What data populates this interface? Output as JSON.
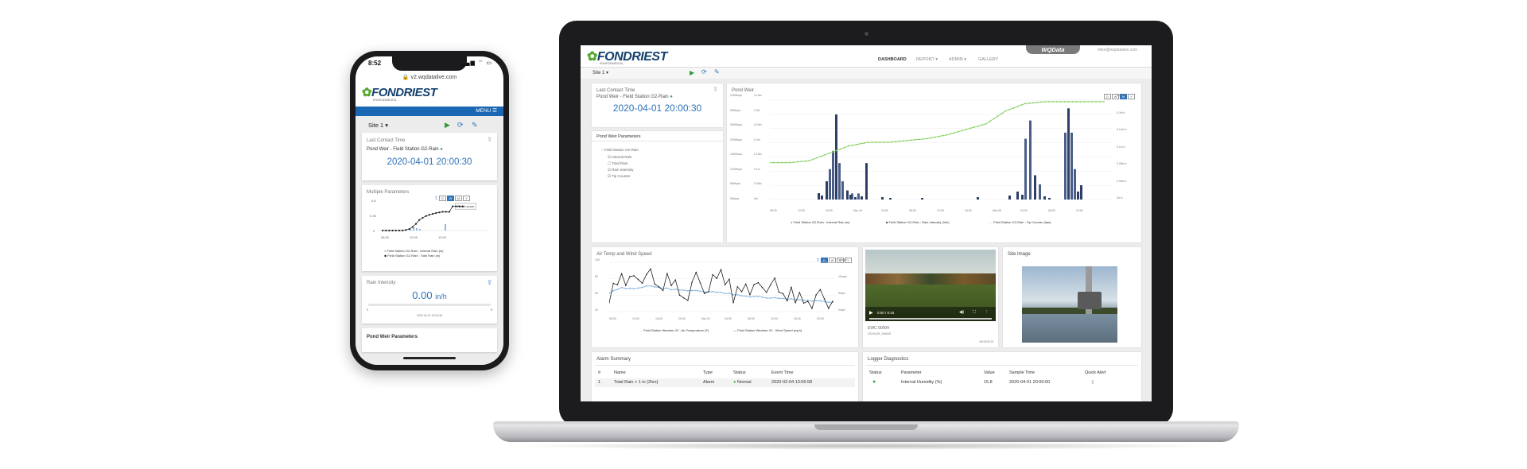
{
  "phone": {
    "status_time": "8:52",
    "url": "v2.wqdatalive.com",
    "logo": "FONDRIEST",
    "logo_sub": "ENVIRONMENTAL",
    "menu_label": "MENU",
    "site_select": "Site 1",
    "last_contact": {
      "title": "Last Contact Time",
      "station": "Pond Weir - Field Station G2-Rain",
      "value": "2020-04-01 20:00:30"
    },
    "multi_params": {
      "title": "Multiple Parameters",
      "zoom_buttons": [
        "D",
        "W",
        "M",
        "Y"
      ],
      "reset_zoom": "Reset zoom",
      "y_ticks": [
        "0.8",
        "0.35",
        "0"
      ],
      "x_ticks": [
        "08:00",
        "12:00",
        "13:00"
      ],
      "legend": [
        "Field Station G2-Rain : Interval Rain (in)",
        "Field Station G2-Rain : Total Rain (in)"
      ]
    },
    "rain_intensity": {
      "title": "Rain Intensity",
      "value": "0.00",
      "unit": "in/h",
      "min": "0",
      "max": "5",
      "time": "2020-04-01 20:00:30"
    },
    "pond_weir_title": "Pond Weir Parameters"
  },
  "laptop": {
    "logo": "FONDRIEST",
    "logo_sub": "ENVIRONMENTAL",
    "nav": [
      "DASHBOARD",
      "REPORT ▾",
      "ADMIN ▾",
      "GALLERY"
    ],
    "brand": "WQData",
    "email": "mike@wqdatalive.com",
    "site_select": "Site 1",
    "last_contact": {
      "title": "Last Contact Time",
      "station": "Pond Weir - Field Station G2-Rain",
      "value": "2020-04-01 20:00:30"
    },
    "pond_weir_params": {
      "title": "Pond Weir Parameters",
      "root": "Field Station G2-Rain",
      "items": [
        {
          "label": "Interval Rain",
          "checked": true
        },
        {
          "label": "Total Rain",
          "checked": false
        },
        {
          "label": "Rain Intensity",
          "checked": true
        },
        {
          "label": "Tip Counter",
          "checked": true
        }
      ]
    },
    "pond_weir_chart": {
      "title": "Pond Weir",
      "zoom_buttons": [
        "D",
        "W",
        "M",
        "Y"
      ],
      "left_ticks": [
        "100Wspa",
        "50Wspa",
        "250Wspa",
        "200Wspa",
        "150Wspa",
        "100Wspa",
        "50Wspa",
        "0Wspa"
      ],
      "mid_ticks": [
        "0.14in",
        "0.3in",
        "0.24in",
        "0.2in",
        "0.15in",
        "0.1in",
        "0.05in",
        "0in"
      ],
      "right_ticks": [
        "0.15in h",
        "0.3in h",
        "0.14in h",
        "0.1in h",
        "0.05in h",
        "0.05in h",
        "0in h"
      ],
      "x_ticks": [
        "08:00",
        "12:00",
        "16:00",
        "Mar 16",
        "04:00",
        "08:00",
        "12:00",
        "16:00",
        "Mar 26",
        "04:00",
        "08:00",
        "12:00"
      ],
      "legend": [
        "Field Station G2-Rain : Interval Rain (in)",
        "Field Station G2-Rain : Rain Intensity (in/h)",
        "Field Station G2-Rain : Tip Counter (tips)"
      ]
    },
    "air_temp_chart": {
      "title": "Air Temp and Wind Speed",
      "zoom_buttons": [
        "D",
        "W",
        "M",
        "Y"
      ],
      "left_ticks": [
        "100",
        "80",
        "60",
        "40"
      ],
      "right_ticks": [
        "15mph",
        "10mph",
        "5mph",
        "0mph"
      ],
      "x_ticks": [
        "08:00",
        "12:00",
        "16:00",
        "20:00",
        "Mar 31",
        "04:00",
        "08:00",
        "12:00",
        "16:00",
        "20:00"
      ],
      "legend": [
        "Field Station Weather X2 : Air Temperature (F)",
        "Field Station Weather X2 : Wind Speed (mph)"
      ]
    },
    "video": {
      "time": "0:00 / 0:15",
      "caption": "EWC 00004",
      "sub": "20191108_145628",
      "date": "06/20/2019"
    },
    "site_image": {
      "title": "Site Image"
    },
    "alarm_summary": {
      "title": "Alarm Summary",
      "headers": [
        "#",
        "Name",
        "Type",
        "Status",
        "Event Time"
      ],
      "rows": [
        {
          "num": "1",
          "name": "Total Rain > 1 in (2hrs)",
          "type": "Alarm",
          "status": "Normal",
          "time": "2020-02-04 13:06:58"
        }
      ]
    },
    "logger_diag": {
      "title": "Logger Diagnostics",
      "headers": [
        "Status",
        "Parameter",
        "Value",
        "Sample Time",
        "Quick Alert"
      ],
      "rows": [
        {
          "param": "Internal Humidity (%)",
          "value": "15.8",
          "time": "2020-04-01 20:00:00"
        }
      ]
    }
  },
  "chart_data": [
    {
      "type": "bar",
      "title": "Pond Weir",
      "series": [
        {
          "name": "Field Station G2-Rain : Interval Rain (in)",
          "values": [
            0.06,
            0.1,
            0.16,
            0.28,
            0.12,
            0.06,
            0.03,
            0.02,
            0.02,
            0.12,
            0.2,
            0.26,
            0.08,
            0.05,
            0.22,
            0.3,
            0.22,
            0.1,
            0.04
          ]
        },
        {
          "name": "Field Station G2-Rain : Tip Counter (tips)",
          "values": [
            0.2,
            0.2,
            0.21,
            0.25,
            0.29,
            0.31,
            0.31,
            0.32,
            0.33,
            0.35,
            0.38,
            0.41,
            0.48,
            0.52,
            0.53,
            0.53,
            0.53,
            0.53
          ]
        }
      ]
    },
    {
      "type": "line",
      "title": "Air Temp and Wind Speed",
      "series": [
        {
          "name": "Field Station Weather X2 : Air Temperature (F)",
          "values": [
            62,
            68,
            66,
            70,
            68,
            66,
            65,
            64,
            63,
            62,
            60,
            58,
            57,
            56,
            55,
            54,
            53,
            52,
            51
          ]
        },
        {
          "name": "Field Station Weather X2 : Wind Speed (mph)",
          "values": [
            5,
            11,
            8,
            12,
            6,
            10,
            4,
            9,
            7,
            11,
            5,
            8,
            6,
            9,
            4,
            5,
            3,
            4,
            3
          ]
        }
      ]
    }
  ]
}
